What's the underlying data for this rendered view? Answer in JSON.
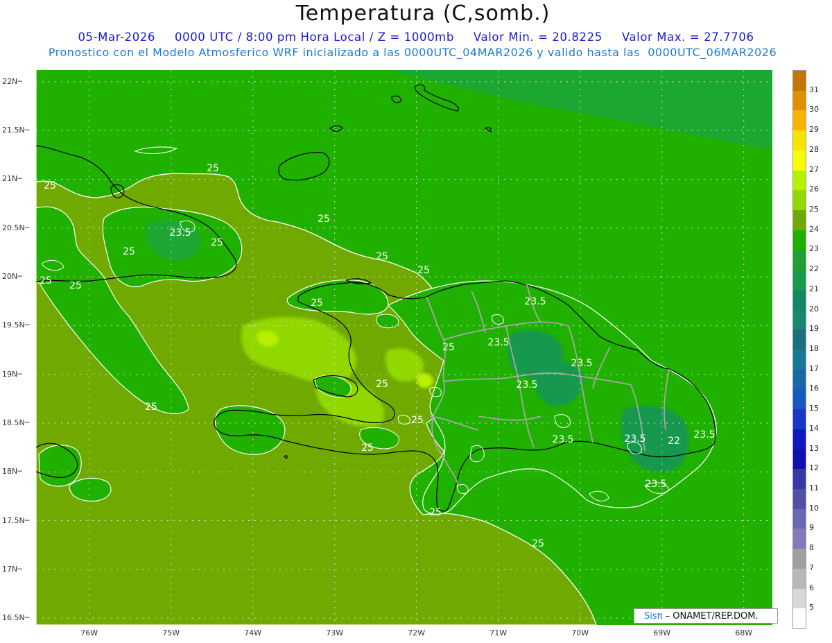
{
  "title": "Temperatura (C,somb.)",
  "subtitle_line1": {
    "date": "05-Mar-2026",
    "time": "0000 UTC / 8:00 pm Hora Local / Z = 1000mb",
    "min": "Valor Min. = 20.8225",
    "max": "Valor Max. = 27.7706"
  },
  "subtitle_line2": "Pronostico con el Modelo Atmosferico WRF inicializado a las 0000UTC_04MAR2026 y valido hasta las  0000UTC_06MAR2026",
  "lat_labels": [
    "22N",
    "21.5N",
    "21N",
    "20.5N",
    "20N",
    "19.5N",
    "19N",
    "18.5N",
    "18N",
    "17.5N",
    "17N",
    "16.5N"
  ],
  "lat_values": [
    22,
    21.5,
    21,
    20.5,
    20,
    19.5,
    19,
    18.5,
    18,
    17.5,
    17,
    16.5
  ],
  "lon_labels": [
    "76W",
    "75W",
    "74W",
    "73W",
    "72W",
    "71W",
    "70W",
    "69W",
    "68W"
  ],
  "lon_values": [
    -76,
    -75,
    -74,
    -73,
    -72,
    -71,
    -70,
    -69,
    -68
  ],
  "map_extent": {
    "lon_min": -76.65,
    "lon_max": -67.65,
    "lat_min": 16.43,
    "lat_max": 22.12
  },
  "contour_labels": [
    "25",
    "25",
    "25",
    "25",
    "25",
    "25",
    "25",
    "25",
    "25",
    "25",
    "25",
    "25",
    "25",
    "25",
    "25",
    "23.5",
    "23.5",
    "23.5",
    "23.5",
    "23.5",
    "23.5",
    "23.5",
    "23.5",
    "22"
  ],
  "legend": {
    "values": [
      31,
      30,
      29,
      28,
      27,
      26,
      25,
      24,
      23,
      22,
      21,
      20,
      19,
      18,
      17,
      16,
      15,
      14,
      13,
      12,
      11,
      10,
      9,
      8,
      7,
      6,
      5
    ],
    "colors": [
      "#c07800",
      "#e09000",
      "#f8b400",
      "#f8e400",
      "#f8fc00",
      "#b8f000",
      "#90d800",
      "#70aa00",
      "#20b000",
      "#20a030",
      "#189850",
      "#108860",
      "#188870",
      "#187080",
      "#187898",
      "#1868a8",
      "#1858c0",
      "#1838c8",
      "#1018c0",
      "#1010b0",
      "#3838a8",
      "#5050a8",
      "#6868b0",
      "#8878b8",
      "#a0a0a0",
      "#b8b8b8",
      "#d8d8d8",
      "#ffffff"
    ]
  },
  "colors": {
    "field_land": "#70aa00",
    "field_green": "#20b000",
    "field_darkgreen": "#189850",
    "field_warm": "#90d800",
    "field_light": "#b8f000"
  },
  "credit": {
    "brand": "Sisπ",
    "text": "– ONAMET/REP.DOM."
  }
}
